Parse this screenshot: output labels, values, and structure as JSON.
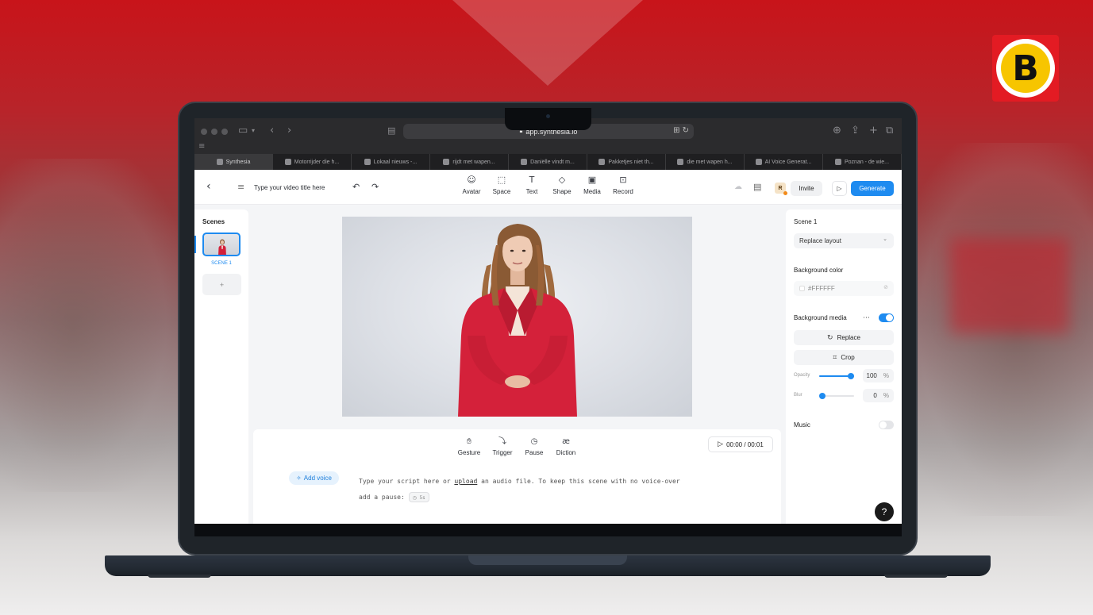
{
  "brand": {
    "logo_letter": "B"
  },
  "browser": {
    "url": "app.synthesia.io",
    "tabs": [
      {
        "label": "Synthesia",
        "active": true
      },
      {
        "label": "Motorrijder die h...",
        "active": false
      },
      {
        "label": "Lokaal nieuws -...",
        "active": false
      },
      {
        "label": "rijdt met wapen...",
        "active": false
      },
      {
        "label": "Daniëlle vindt m...",
        "active": false
      },
      {
        "label": "Pakketjes niet th...",
        "active": false
      },
      {
        "label": "die met wapen h...",
        "active": false
      },
      {
        "label": "AI Voice Generat...",
        "active": false
      },
      {
        "label": "Poznan - de wie...",
        "active": false
      }
    ]
  },
  "toolbar": {
    "title_placeholder": "Type your video title here",
    "tools": [
      {
        "name": "avatar",
        "label": "Avatar",
        "icon": "avatar-icon"
      },
      {
        "name": "space",
        "label": "Space",
        "icon": "space-icon"
      },
      {
        "name": "text",
        "label": "Text",
        "icon": "text-icon"
      },
      {
        "name": "shape",
        "label": "Shape",
        "icon": "shape-icon"
      },
      {
        "name": "media",
        "label": "Media",
        "icon": "media-icon"
      },
      {
        "name": "record",
        "label": "Record",
        "icon": "record-icon"
      }
    ],
    "user_initial": "R",
    "invite_label": "Invite",
    "generate_label": "Generate"
  },
  "scenes": {
    "title": "Scenes",
    "items": [
      {
        "label": "SCENE 1",
        "selected": true
      }
    ],
    "add_label": "+"
  },
  "script": {
    "tools": [
      {
        "name": "gesture",
        "label": "Gesture"
      },
      {
        "name": "trigger",
        "label": "Trigger"
      },
      {
        "name": "pause",
        "label": "Pause"
      },
      {
        "name": "diction",
        "label": "Diction"
      }
    ],
    "timecode": "00:00 / 00:01",
    "add_voice_label": "Add voice",
    "text_before_link": "Type your script here or ",
    "link_text": "upload",
    "text_after_link": " an audio file. To keep this scene with no voice-over add a pause:",
    "pause_chip": "5s"
  },
  "properties": {
    "scene_title": "Scene 1",
    "layout_select": "Replace layout",
    "background_color_label": "Background color",
    "background_color_value": "#FFFFFF",
    "background_media_label": "Background media",
    "background_media_enabled": true,
    "replace_label": "Replace",
    "crop_label": "Crop",
    "opacity_label": "Opacity",
    "opacity_value": "100",
    "opacity_fraction": 1.0,
    "blur_label": "Blur",
    "blur_value": "0",
    "blur_fraction": 0.0,
    "percent_sign": "%",
    "music_label": "Music",
    "music_enabled": false
  },
  "help_label": "?",
  "colors": {
    "accent": "#1e8bf0",
    "brand_red": "#e31b23",
    "brand_yellow": "#f7c500",
    "blazer_red": "#d4213a"
  }
}
